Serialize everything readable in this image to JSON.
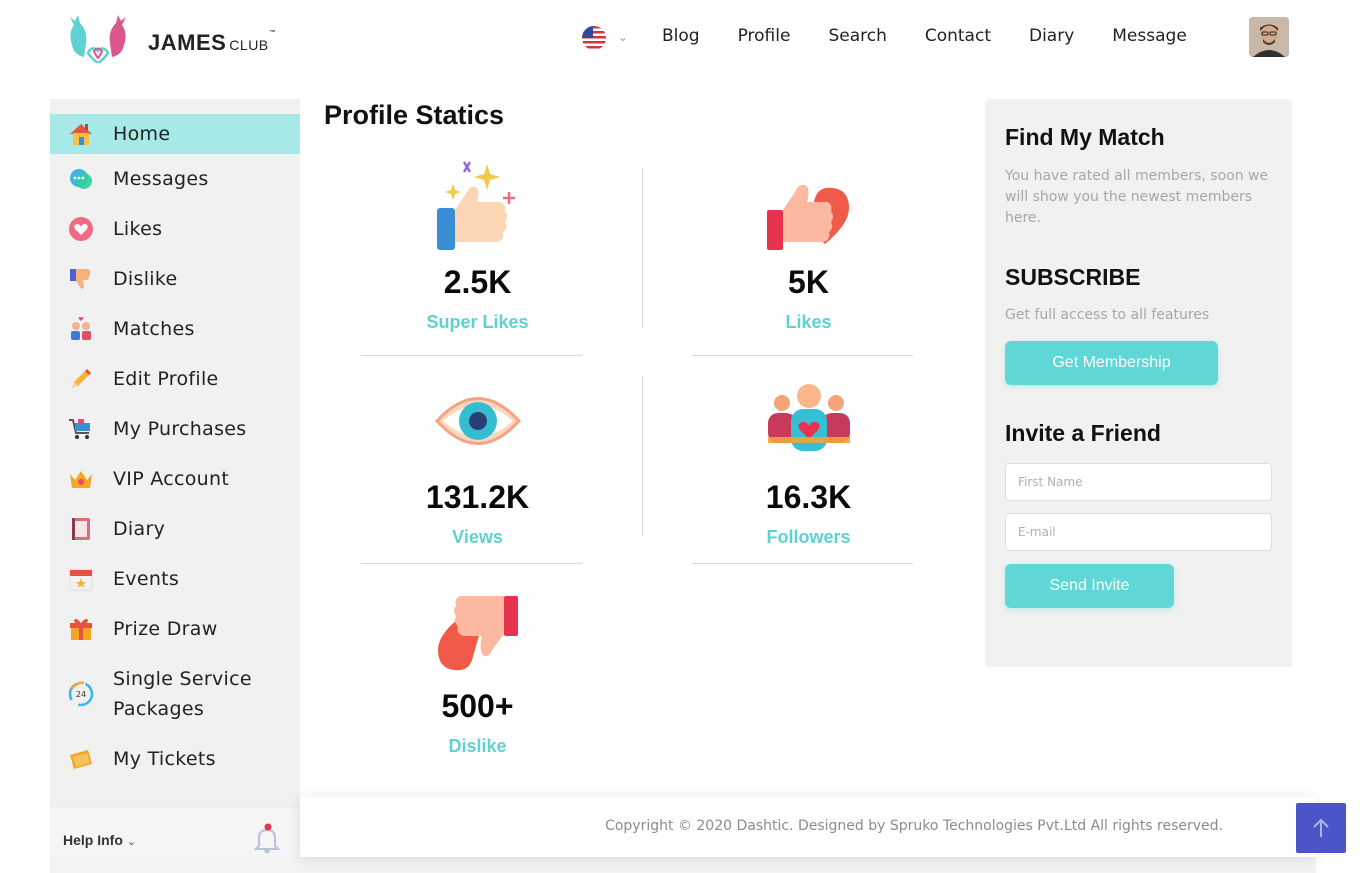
{
  "brand": {
    "name": "JAMES",
    "suffix": "CLUB",
    "tm": "™"
  },
  "nav": {
    "language": "English (US)",
    "items": [
      "Blog",
      "Profile",
      "Search",
      "Contact",
      "Diary",
      "Message"
    ]
  },
  "sidebar": {
    "items": [
      {
        "label": "Home",
        "icon": "home-icon",
        "active": true
      },
      {
        "label": "Messages",
        "icon": "messages-icon"
      },
      {
        "label": "Likes",
        "icon": "heart-icon"
      },
      {
        "label": "Dislike",
        "icon": "thumbs-down-icon"
      },
      {
        "label": "Matches",
        "icon": "couple-icon"
      },
      {
        "label": "Edit Profile",
        "icon": "pencil-icon"
      },
      {
        "label": "My Purchases",
        "icon": "cart-icon"
      },
      {
        "label": "VIP Account",
        "icon": "crown-icon"
      },
      {
        "label": "Diary",
        "icon": "diary-icon"
      },
      {
        "label": "Events",
        "icon": "calendar-icon"
      },
      {
        "label": "Prize Draw",
        "icon": "gift-icon"
      },
      {
        "label": "Single Service Packages",
        "icon": "24h-icon"
      },
      {
        "label": "My Tickets",
        "icon": "ticket-icon"
      }
    ],
    "help": "Help Info"
  },
  "main": {
    "title": "Profile Statics",
    "stats": [
      {
        "value": "2.5K",
        "label": "Super Likes",
        "icon": "super-like-icon"
      },
      {
        "value": "5K",
        "label": "Likes",
        "icon": "like-heart-icon"
      },
      {
        "value": "131.2K",
        "label": "Views",
        "icon": "eye-icon"
      },
      {
        "value": "16.3K",
        "label": "Followers",
        "icon": "followers-icon"
      },
      {
        "value": "500+",
        "label": "Dislike",
        "icon": "dislike-heart-icon"
      }
    ]
  },
  "panel": {
    "match_title": "Find My Match",
    "match_text": "You have rated all members, soon we will show you the newest members here.",
    "subscribe_title": "SUBSCRIBE",
    "subscribe_text": "Get full access to all features",
    "membership_button": "Get Membership",
    "invite_title": "Invite a Friend",
    "first_name_placeholder": "First Name",
    "email_placeholder": "E-mail",
    "invite_button": "Send Invite"
  },
  "footer": {
    "copyright": "Copyright © 2020 Dashtic. Designed by Spruko Technologies Pvt.Ltd All rights reserved."
  },
  "colors": {
    "accent": "#5ED7D6",
    "active": "#A6E9E7",
    "top_button": "#4B55C8"
  }
}
